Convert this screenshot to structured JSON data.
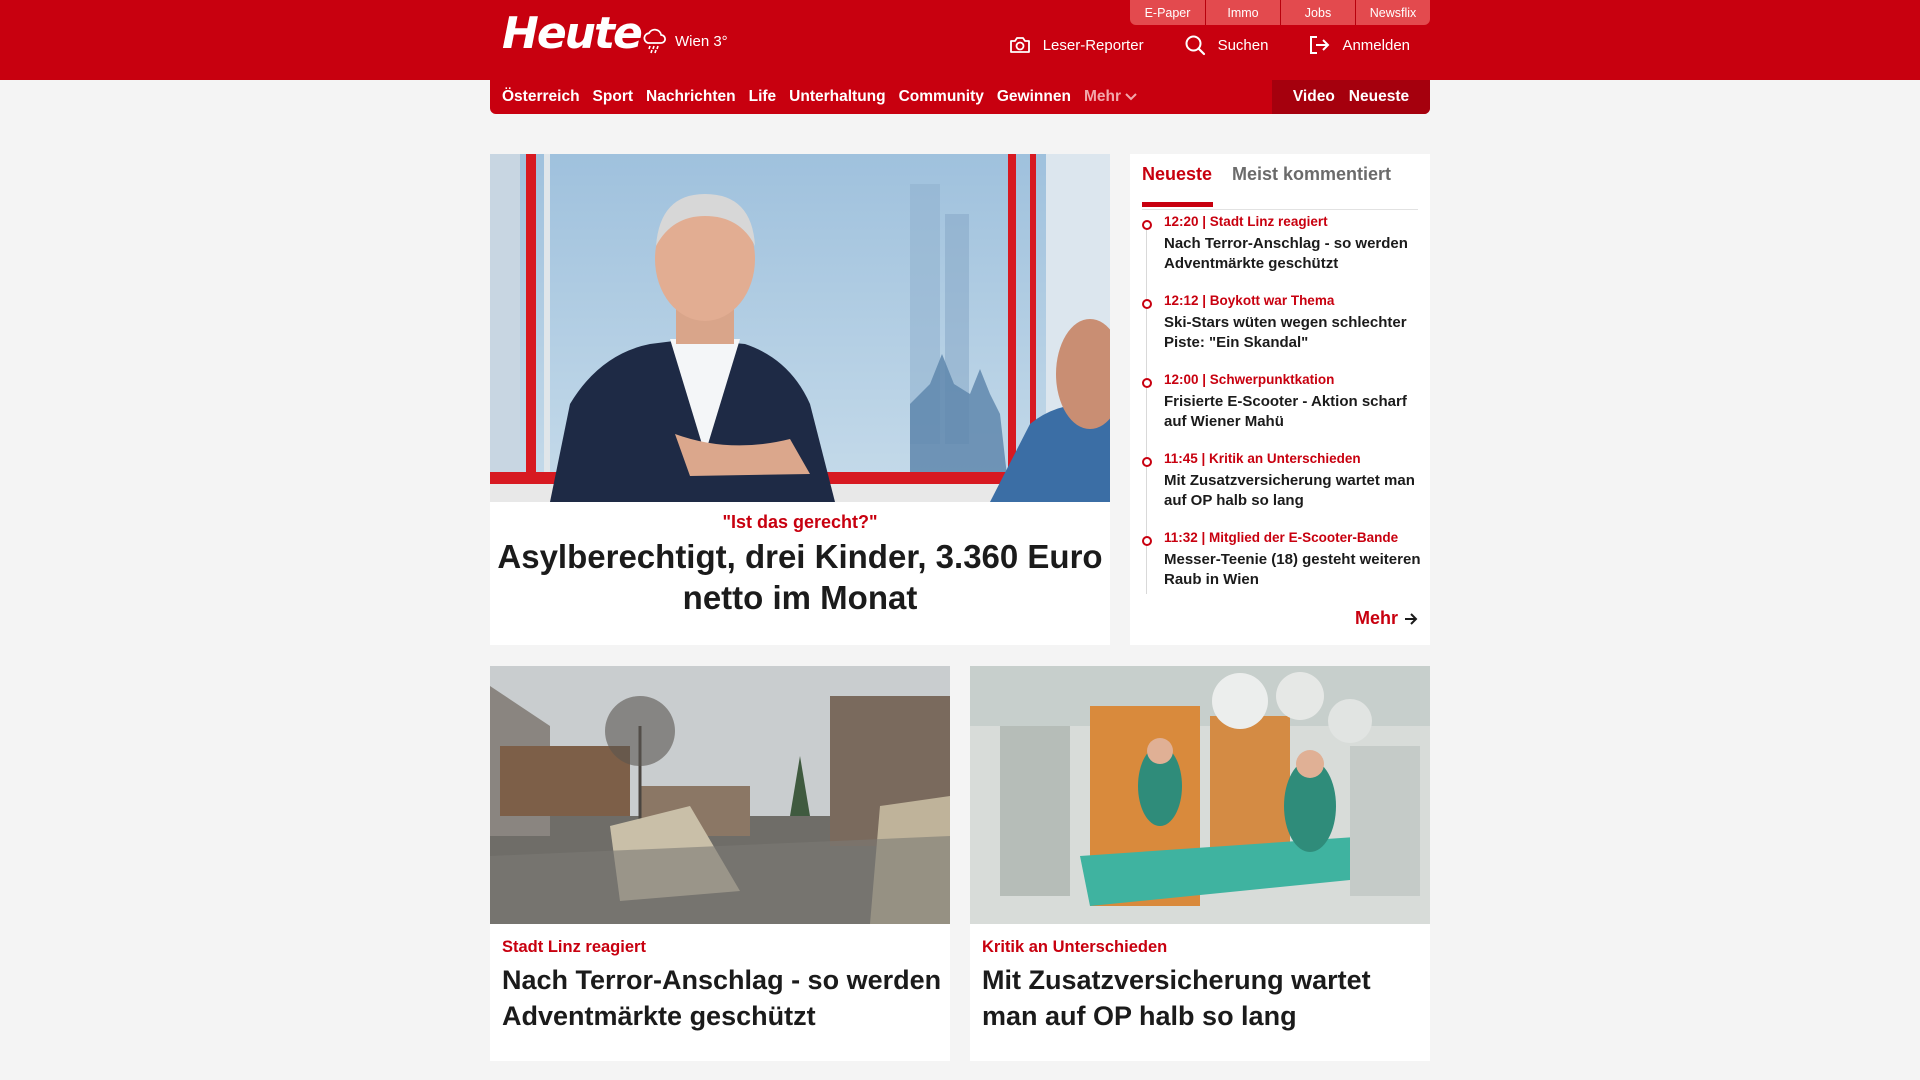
{
  "brand": {
    "logo": "Heute",
    "accent": "#c8000f"
  },
  "weather": {
    "label": "Wien 3°",
    "icon": "rain-cloud-icon"
  },
  "utility_links": [
    {
      "label": "E-Paper"
    },
    {
      "label": "Immo"
    },
    {
      "label": "Jobs"
    },
    {
      "label": "Newsflix"
    }
  ],
  "header_actions": {
    "reporter": {
      "label": "Leser-Reporter",
      "icon": "camera-icon"
    },
    "search": {
      "label": "Suchen",
      "icon": "search-icon"
    },
    "login": {
      "label": "Anmelden",
      "icon": "login-icon"
    }
  },
  "nav": {
    "items": [
      {
        "label": "Österreich"
      },
      {
        "label": "Sport"
      },
      {
        "label": "Nachrichten"
      },
      {
        "label": "Life"
      },
      {
        "label": "Unterhaltung"
      },
      {
        "label": "Community"
      },
      {
        "label": "Gewinnen"
      }
    ],
    "more": "Mehr",
    "video": "Video",
    "latest": "Neueste"
  },
  "hero": {
    "kicker": "\"Ist das gerecht?\"",
    "title": "Asylberechtigt, drei Kinder, 3.360 Euro netto im Monat"
  },
  "sidebar": {
    "tabs": {
      "active": "Neueste",
      "inactive": "Meist kommentiert"
    },
    "items": [
      {
        "meta": "12:20 | Stadt Linz reagiert",
        "title": "Nach Terror-Anschlag - so werden Adventmärkte geschützt"
      },
      {
        "meta": "12:12 | Boykott war Thema",
        "title": "Ski-Stars wüten wegen schlechter Piste: \"Ein Skandal\""
      },
      {
        "meta": "12:00 | Schwerpunktkation",
        "title": "Frisierte E-Scooter - Aktion scharf auf Wiener Mahü"
      },
      {
        "meta": "11:45 | Kritik an Unterschieden",
        "title": "Mit Zusatzversicherung wartet man auf OP halb so lang"
      },
      {
        "meta": "11:32 | Mitglied der E-Scooter-Bande",
        "title": "Messer-Teenie (18) gesteht weiteren Raub in Wien"
      }
    ],
    "more": "Mehr"
  },
  "cards": [
    {
      "kicker": "Stadt Linz reagiert",
      "title": "Nach Terror-Anschlag - so werden Adventmärkte geschützt"
    },
    {
      "kicker": "Kritik an Unterschieden",
      "title": "Mit Zusatzversicherung wartet man auf OP halb so lang"
    }
  ]
}
